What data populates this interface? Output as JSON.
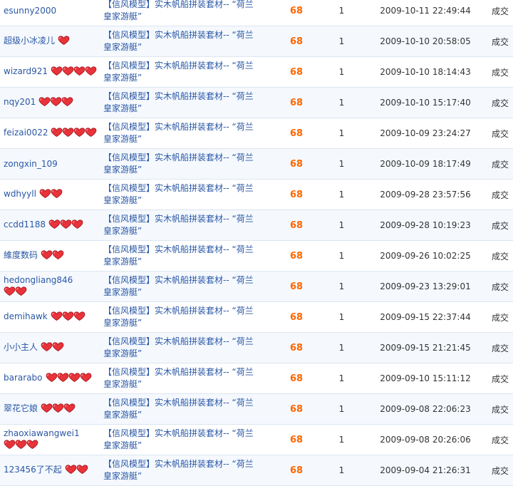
{
  "status_label": "成交",
  "rows": [
    {
      "buyer": "esunny2000",
      "hearts": 0,
      "item": "【信风模型】实木帆船拼装套材-- “荷兰皇家游艇”",
      "price": "68",
      "qty": "1",
      "time": "2009-10-11 22:49:44"
    },
    {
      "buyer": "超级小冰凌儿",
      "hearts": 1,
      "item": "【信风模型】实木帆船拼装套材-- “荷兰皇家游艇”",
      "price": "68",
      "qty": "1",
      "time": "2009-10-10 20:58:05"
    },
    {
      "buyer": "wizard921",
      "hearts": 4,
      "item": "【信风模型】实木帆船拼装套材-- “荷兰皇家游艇”",
      "price": "68",
      "qty": "1",
      "time": "2009-10-10 18:14:43"
    },
    {
      "buyer": "nqy201",
      "hearts": 3,
      "item": "【信风模型】实木帆船拼装套材-- “荷兰皇家游艇”",
      "price": "68",
      "qty": "1",
      "time": "2009-10-10 15:17:40"
    },
    {
      "buyer": "feizai0022",
      "hearts": 4,
      "item": "【信风模型】实木帆船拼装套材-- “荷兰皇家游艇”",
      "price": "68",
      "qty": "1",
      "time": "2009-10-09 23:24:27"
    },
    {
      "buyer": "zongxin_109",
      "hearts": 0,
      "item": "【信风模型】实木帆船拼装套材-- “荷兰皇家游艇”",
      "price": "68",
      "qty": "1",
      "time": "2009-10-09 18:17:49"
    },
    {
      "buyer": "wdhyyll",
      "hearts": 2,
      "item": "【信风模型】实木帆船拼装套材-- “荷兰皇家游艇”",
      "price": "68",
      "qty": "1",
      "time": "2009-09-28 23:57:56"
    },
    {
      "buyer": "ccdd1188",
      "hearts": 3,
      "item": "【信风模型】实木帆船拼装套材-- “荷兰皇家游艇”",
      "price": "68",
      "qty": "1",
      "time": "2009-09-28 10:19:23"
    },
    {
      "buyer": "維度数码",
      "hearts": 2,
      "item": "【信风模型】实木帆船拼装套材-- “荷兰皇家游艇”",
      "price": "68",
      "qty": "1",
      "time": "2009-09-26 10:02:25"
    },
    {
      "buyer": "hedongliang846",
      "hearts": 2,
      "item": "【信风模型】实木帆船拼装套材-- “荷兰皇家游艇”",
      "price": "68",
      "qty": "1",
      "time": "2009-09-23 13:29:01"
    },
    {
      "buyer": "demihawk",
      "hearts": 3,
      "item": "【信风模型】实木帆船拼装套材-- “荷兰皇家游艇”",
      "price": "68",
      "qty": "1",
      "time": "2009-09-15 22:37:44"
    },
    {
      "buyer": "小小主人",
      "hearts": 2,
      "item": "【信风模型】实木帆船拼装套材-- “荷兰皇家游艇”",
      "price": "68",
      "qty": "1",
      "time": "2009-09-15 21:21:45"
    },
    {
      "buyer": "bararabo",
      "hearts": 4,
      "item": "【信风模型】实木帆船拼装套材-- “荷兰皇家游艇”",
      "price": "68",
      "qty": "1",
      "time": "2009-09-10 15:11:12"
    },
    {
      "buyer": "翠花它娘",
      "hearts": 3,
      "item": "【信风模型】实木帆船拼装套材-- “荷兰皇家游艇”",
      "price": "68",
      "qty": "1",
      "time": "2009-09-08 22:06:23"
    },
    {
      "buyer": "zhaoxiawangwei1",
      "hearts": 3,
      "item": "【信风模型】实木帆船拼装套材-- “荷兰皇家游艇”",
      "price": "68",
      "qty": "1",
      "time": "2009-09-08 20:26:06"
    },
    {
      "buyer": "123456了不起",
      "hearts": 2,
      "item": "【信风模型】实木帆船拼装套材-- “荷兰皇家游艇”",
      "price": "68",
      "qty": "1",
      "time": "2009-09-04 21:26:31"
    }
  ]
}
